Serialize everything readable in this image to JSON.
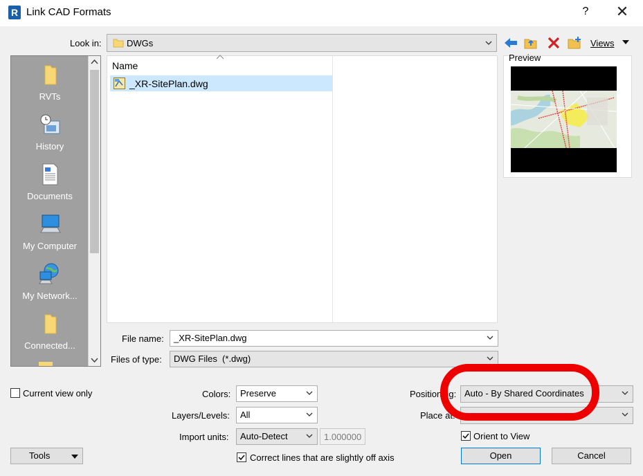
{
  "window": {
    "app_icon_letter": "R",
    "title": "Link CAD Formats",
    "help": "?",
    "close": "✕"
  },
  "look_in": {
    "label": "Look in:",
    "value": "DWGs",
    "views_label": "Views"
  },
  "places": [
    {
      "label": "RVTs",
      "icon": "folder-icon"
    },
    {
      "label": "History",
      "icon": "history-icon"
    },
    {
      "label": "Documents",
      "icon": "documents-icon"
    },
    {
      "label": "My Computer",
      "icon": "computer-icon"
    },
    {
      "label": "My Network...",
      "icon": "network-icon"
    },
    {
      "label": "Connected...",
      "icon": "folder-icon"
    }
  ],
  "file_list": {
    "column_name": "Name",
    "files": [
      {
        "name": "_XR-SitePlan.dwg",
        "selected": true
      }
    ]
  },
  "preview": {
    "label": "Preview"
  },
  "file_name": {
    "label": "File name:",
    "value": "_XR-SitePlan.dwg"
  },
  "files_of_type": {
    "label": "Files of type:",
    "value": "DWG Files  (*.dwg)"
  },
  "options": {
    "current_view_only": {
      "label": "Current view only",
      "checked": false
    },
    "colors": {
      "label": "Colors:",
      "value": "Preserve"
    },
    "layers": {
      "label": "Layers/Levels:",
      "value": "All"
    },
    "import_units": {
      "label": "Import units:",
      "value": "Auto-Detect"
    },
    "scale": "1.000000",
    "correct_lines": {
      "label": "Correct lines that are slightly off axis",
      "checked": true
    },
    "positioning": {
      "label": "Positioning:",
      "value": "Auto - By Shared Coordinates"
    },
    "place_at": {
      "label": "Place at:",
      "value": ""
    },
    "orient_to_view": {
      "label": "Orient to View",
      "checked": true
    }
  },
  "buttons": {
    "tools": "Tools",
    "open": "Open",
    "cancel": "Cancel"
  },
  "colors": {
    "selection": "#cce8ff",
    "annotation_circle": "#ee0000",
    "places_bg": "#a0a0a0"
  }
}
